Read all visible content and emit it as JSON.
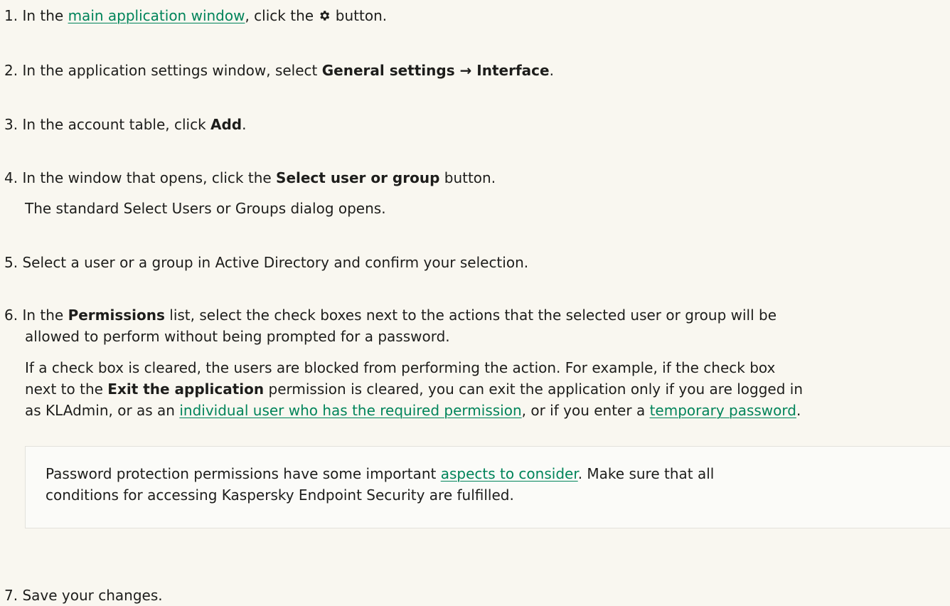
{
  "steps": [
    {
      "num": "1.",
      "before": "In the ",
      "link": "main application window",
      "middle": ", click the ",
      "icon": "gear-icon",
      "after": " button."
    },
    {
      "num": "2.",
      "before": "In the application settings window, select ",
      "bold1": "General settings",
      "arrow": " → ",
      "bold2": "Interface",
      "after": "."
    },
    {
      "num": "3.",
      "before": "In the account table, click ",
      "bold": "Add",
      "after": "."
    },
    {
      "num": "4.",
      "before": "In the window that opens, click the ",
      "bold": "Select user or group",
      "after": " button.",
      "sub": "The standard Select Users or Groups dialog opens."
    },
    {
      "num": "5.",
      "text": "Select a user or a group in Active Directory and confirm your selection."
    },
    {
      "num": "6.",
      "before": "In the ",
      "bold": "Permissions",
      "after_line1": " list, select the check boxes next to the actions that the selected user or group will be",
      "line2": "allowed to perform without being prompted for a password.",
      "sub": {
        "line1": "If a check box is cleared, the users are blocked from performing the action. For example, if the check box",
        "line2_before": "next to the ",
        "line2_bold": "Exit the application",
        "line2_after": " permission is cleared, you can exit the application only if you are logged in",
        "line3_before": "as KLAdmin, or as an ",
        "line3_link1": "individual user who has the required permission",
        "line3_middle": ", or if you enter a ",
        "line3_link2": "temporary password",
        "line3_after": "."
      },
      "note": {
        "line1_before": "Password protection permissions have some important ",
        "line1_link": "aspects to consider",
        "line1_after": ". Make sure that all",
        "line2": "conditions for accessing Kaspersky Endpoint Security are fulfilled."
      }
    },
    {
      "num": "7.",
      "text": "Save your changes."
    }
  ],
  "colors": {
    "link": "#00845a",
    "text": "#1d1d1b",
    "background": "#f9f7f0"
  }
}
